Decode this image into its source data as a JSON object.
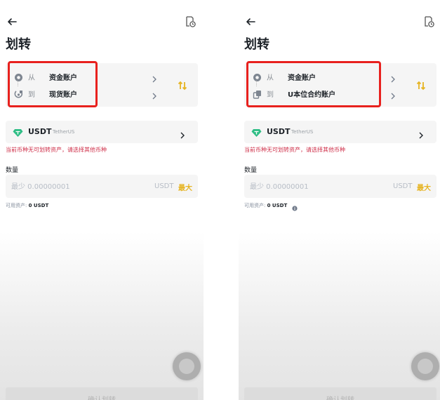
{
  "panels": [
    {
      "title": "划转",
      "from_label": "从",
      "from_value": "资金账户",
      "to_label": "到",
      "to_value": "现货账户",
      "coin": "USDT",
      "coin_full": "TetherUS",
      "warning": "当前币种无可划转资产，请选择其他币种",
      "amount_label": "数量",
      "amount_placeholder": "最少 0.00000001",
      "amount_unit": "USDT",
      "max_label": "最大",
      "available_label": "可用资产:",
      "available_value": "0 USDT",
      "confirm_label": "确认划转"
    },
    {
      "title": "划转",
      "from_label": "从",
      "from_value": "资金账户",
      "to_label": "到",
      "to_value": "U本位合约账户",
      "coin": "USDT",
      "coin_full": "TetherUS",
      "warning": "当前币种无可划转资产，请选择其他币种",
      "amount_label": "数量",
      "amount_placeholder": "最少 0.00000001",
      "amount_unit": "USDT",
      "max_label": "最大",
      "available_label": "可用资产:",
      "available_value": "0 USDT",
      "confirm_label": "确认划转"
    }
  ],
  "colors": {
    "highlight": "#e8211e",
    "accent": "#e6b422",
    "warning": "#cf304a",
    "coin_icon": "#2ebd85"
  },
  "icons": {
    "back": "arrow-left-icon",
    "history": "history-icon",
    "from": "wallet-circle-icon",
    "to_panel1": "spot-account-icon",
    "to_panel2": "futures-account-icon",
    "swap": "swap-vertical-icon",
    "coin": "usdt-diamond-icon",
    "chevron": "chevron-right-icon",
    "info": "info-icon"
  }
}
